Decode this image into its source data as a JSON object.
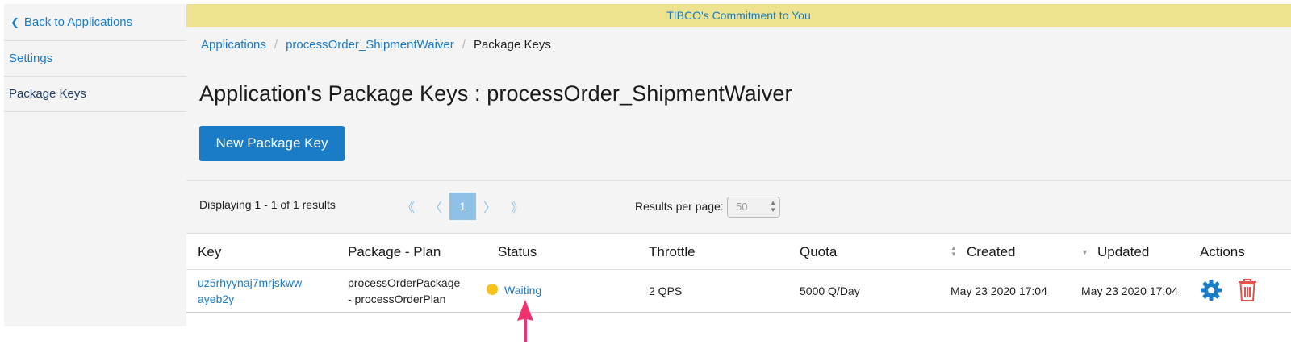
{
  "sidebar": {
    "back_label": "Back to Applications",
    "items": [
      {
        "label": "Settings"
      },
      {
        "label": "Package Keys"
      }
    ]
  },
  "banner": {
    "text": "TIBCO's Commitment to You"
  },
  "breadcrumb": [
    {
      "label": "Applications"
    },
    {
      "label": "processOrder_ShipmentWaiver"
    },
    {
      "label": "Package Keys"
    }
  ],
  "page": {
    "title": "Application's Package Keys : processOrder_ShipmentWaiver",
    "new_button": "New Package Key"
  },
  "pagination": {
    "displaying": "Displaying 1 - 1 of 1 results",
    "first": "《",
    "prev": "〈",
    "current": "1",
    "next": "〉",
    "last": "》",
    "results_per_page_label": "Results per page:",
    "results_per_page_value": "50"
  },
  "table": {
    "columns": [
      "Key",
      "Package - Plan",
      "Status",
      "Throttle",
      "Quota",
      "Created",
      "Updated",
      "Actions"
    ],
    "rows": [
      {
        "key_line1": "uz5rhyynaj7mrjskww",
        "key_line2": "ayeb2y",
        "plan_line1": "processOrderPackage",
        "plan_line2": "- processOrderPlan",
        "status": "Waiting",
        "throttle": "2 QPS",
        "quota": "5000 Q/Day",
        "created": "May 23 2020 17:04",
        "updated": "May 23 2020 17:04",
        "actions": [
          "gear-icon",
          "trash-icon"
        ]
      }
    ]
  },
  "colors": {
    "accent": "#1a7cc7",
    "banner": "#efe28f",
    "status_waiting": "#f7c21b",
    "delete": "#e8534f",
    "annotation_arrow": "#f0326e"
  }
}
